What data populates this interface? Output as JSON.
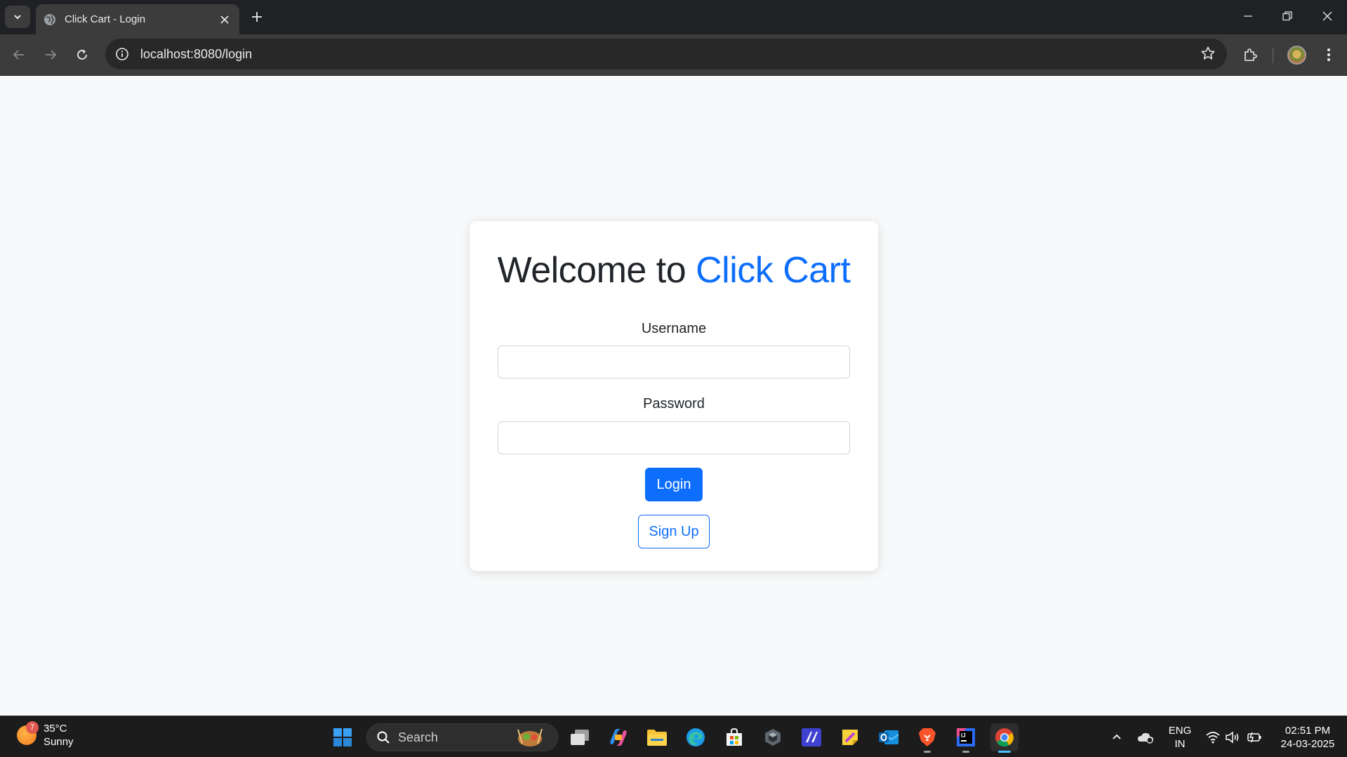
{
  "browser": {
    "tab_title": "Click Cart - Login",
    "url": "localhost:8080/login"
  },
  "page": {
    "heading_prefix": "Welcome to ",
    "heading_brand": "Click Cart",
    "username_label": "Username",
    "username_value": "",
    "password_label": "Password",
    "password_value": "",
    "login_button": "Login",
    "signup_button": "Sign Up",
    "brand_color": "#0d6efd"
  },
  "taskbar": {
    "weather_temp": "35°C",
    "weather_desc": "Sunny",
    "weather_badge": "7",
    "search_label": "Search",
    "lang_primary": "ENG",
    "lang_secondary": "IN",
    "time": "02:51 PM",
    "date": "24-03-2025",
    "pinned_apps": [
      "start-icon",
      "task-view-icon",
      "copilot-icon",
      "file-explorer-icon",
      "edge-icon",
      "store-icon",
      "app-dark-icon",
      "visual-studio-icon",
      "sticky-notes-icon",
      "outlook-icon",
      "brave-icon",
      "intellij-icon",
      "chrome-icon"
    ]
  }
}
